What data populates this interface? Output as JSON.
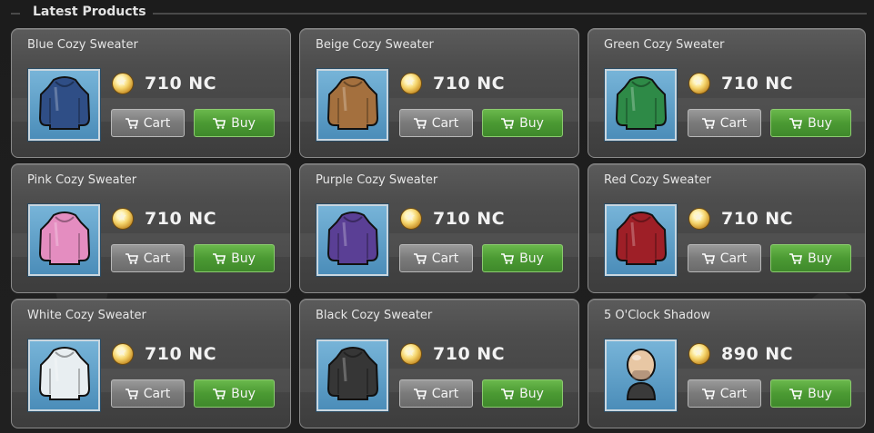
{
  "section": {
    "title": "Latest Products"
  },
  "buttons": {
    "cart": "Cart",
    "buy": "Buy"
  },
  "products": [
    {
      "name": "Blue Cozy Sweater",
      "price": "710 NC",
      "color": "#2f4e86",
      "icon": "sweater-icon"
    },
    {
      "name": "Beige Cozy Sweater",
      "price": "710 NC",
      "color": "#a4703e",
      "icon": "sweater-icon"
    },
    {
      "name": "Green Cozy Sweater",
      "price": "710 NC",
      "color": "#2e8a47",
      "icon": "sweater-icon"
    },
    {
      "name": "Pink Cozy Sweater",
      "price": "710 NC",
      "color": "#e48dc0",
      "icon": "sweater-icon"
    },
    {
      "name": "Purple Cozy Sweater",
      "price": "710 NC",
      "color": "#5a3f95",
      "icon": "sweater-icon"
    },
    {
      "name": "Red Cozy Sweater",
      "price": "710 NC",
      "color": "#9e1f27",
      "icon": "sweater-icon"
    },
    {
      "name": "White Cozy Sweater",
      "price": "710 NC",
      "color": "#e8eef1",
      "icon": "sweater-icon"
    },
    {
      "name": "Black Cozy Sweater",
      "price": "710 NC",
      "color": "#363636",
      "icon": "sweater-icon"
    },
    {
      "name": "5 O'Clock Shadow",
      "price": "890 NC",
      "color": "#e8c7a4",
      "icon": "bald-head-icon"
    }
  ]
}
